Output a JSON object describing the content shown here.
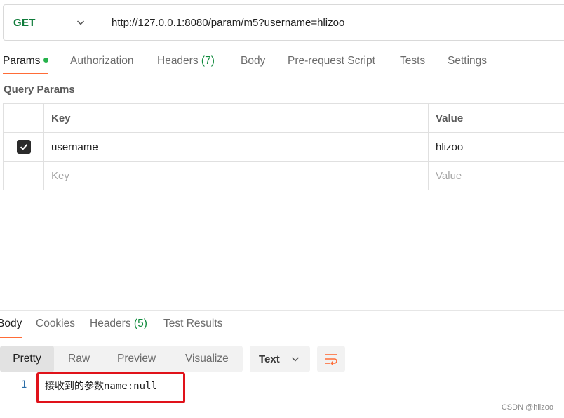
{
  "request": {
    "method": "GET",
    "url": "http://127.0.0.1:8080/param/m5?username=hlizoo"
  },
  "request_tabs": [
    {
      "label": "Params",
      "active": true,
      "indicator": true
    },
    {
      "label": "Authorization"
    },
    {
      "label": "Headers",
      "count": "(7)"
    },
    {
      "label": "Body"
    },
    {
      "label": "Pre-request Script"
    },
    {
      "label": "Tests"
    },
    {
      "label": "Settings"
    }
  ],
  "query_params": {
    "title": "Query Params",
    "columns": {
      "key": "Key",
      "value": "Value"
    },
    "rows": [
      {
        "checked": true,
        "key": "username",
        "value": "hlizoo"
      }
    ],
    "placeholder": {
      "key": "Key",
      "value": "Value"
    }
  },
  "response": {
    "tabs": [
      {
        "label": "Body",
        "active": true
      },
      {
        "label": "Cookies"
      },
      {
        "label": "Headers",
        "count": "(5)"
      },
      {
        "label": "Test Results"
      }
    ],
    "views": [
      "Pretty",
      "Raw",
      "Preview",
      "Visualize"
    ],
    "format": "Text",
    "line_number": "1",
    "body_text": "接收到的参数name:null"
  },
  "watermark": "CSDN @hlizoo",
  "colors": {
    "accent": "#ff6c37",
    "method": "#0f7b3a",
    "count": "#0f8a3c",
    "highlight_box": "#e0121a"
  }
}
